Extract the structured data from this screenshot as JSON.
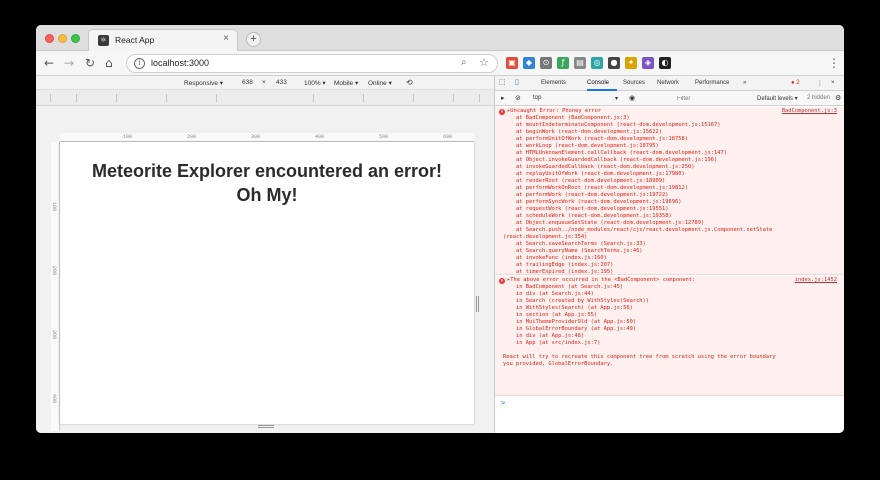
{
  "browser": {
    "tab_title": "React App",
    "tab_favicon": "⚛",
    "tab_close": "×",
    "new_tab": "+",
    "url": "localhost:3000",
    "back_icon": "←",
    "forward_icon": "→",
    "reload_icon": "↻",
    "home_icon": "⌂",
    "info_icon": "i",
    "search_icon": "⌕",
    "star_icon": "☆",
    "menu_icon": "⋮",
    "extensions": [
      {
        "name": "extension-red-icon",
        "color": "#e04b3f",
        "glyph": "▣"
      },
      {
        "name": "extension-blue-icon",
        "color": "#2f86d6",
        "glyph": "◆"
      },
      {
        "name": "extension-lens-icon",
        "color": "#777777",
        "glyph": "⊙"
      },
      {
        "name": "extension-green-icon",
        "color": "#3ba55c",
        "glyph": "ƒ"
      },
      {
        "name": "extension-gray-icon",
        "color": "#888888",
        "glyph": "▤"
      },
      {
        "name": "extension-teal-icon",
        "color": "#2ba5a5",
        "glyph": "◎"
      },
      {
        "name": "extension-dark-icon",
        "color": "#444444",
        "glyph": "●"
      },
      {
        "name": "extension-yellow-icon",
        "color": "#d9a400",
        "glyph": "✦"
      },
      {
        "name": "extension-purple-icon",
        "color": "#7d54c4",
        "glyph": "◈"
      },
      {
        "name": "extension-black-icon",
        "color": "#222222",
        "glyph": "◐"
      }
    ]
  },
  "device_toolbar": {
    "device": "Responsive ▾",
    "width": "638",
    "times": "×",
    "height": "433",
    "zoom": "100% ▾",
    "network": "Mobile ▾",
    "online": "Online ▾",
    "rotate_icon": "⟲"
  },
  "ruler": {
    "top_labels": [
      "100",
      "200",
      "300",
      "400",
      "500",
      "600"
    ],
    "left_labels": [
      "100",
      "200",
      "300",
      "400"
    ]
  },
  "page": {
    "error_line1": "Meteorite Explorer encountered an error!",
    "error_line2": "Oh My!"
  },
  "devtools": {
    "tabs": [
      "Elements",
      "Console",
      "Sources",
      "Network",
      "Performance",
      "»"
    ],
    "error_count": "2",
    "context": "top",
    "context_arrow": "▾",
    "eye_icon": "◉",
    "filter_placeholder": "Filter",
    "levels": "Default levels ▾",
    "hidden": "2 hidden",
    "settings_icon": "⚙",
    "clear_icon": "⊘",
    "more_icon": "⋮",
    "close_icon": "×"
  },
  "console": {
    "error1_lines": [
      "▸Uncaught Error: Phoney error",
      "    at BadComponent (BadComponent.js:3)",
      "    at mountIndeterminateComponent (react-dom.development.js:15167)",
      "    at beginWork (react-dom.development.js:15622)",
      "    at performUnitOfWork (react-dom.development.js:18758)",
      "    at workLoop (react-dom.development.js:18795)",
      "    at HTMLUnknownElement.callCallback (react-dom.development.js:147)",
      "    at Object.invokeGuardedCallback (react-dom.development.js:196)",
      "    at invokeGuardedCallback (react-dom.development.js:250)",
      "    at replayUnitOfWork (react-dom.development.js:17980)",
      "    at renderRoot (react-dom.development.js:18909)",
      "    at performWorkOnRoot (react-dom.development.js:19812)",
      "    at performWork (react-dom.development.js:19722)",
      "    at performSyncWork (react-dom.development.js:19696)",
      "    at requestWork (react-dom.development.js:19551)",
      "    at scheduleWork (react-dom.development.js:19358)",
      "    at Object.enqueueSetState (react-dom.development.js:12789)",
      "    at Search.push../node_modules/react/cjs/react.development.js.Component.setState",
      "(react.development.js:354)",
      "    at Search.saveSearchTerms (Search.js:33)",
      "    at Search.queryName (SearchTerms.js:46)",
      "    at invokeFunc (index.js:160)",
      "    at trailingEdge (index.js:207)",
      "    at timerExpired (index.js:195)"
    ],
    "error1_source": "BadComponent.js:3",
    "error2_lines": [
      "▸The above error occurred in the <BadComponent> component:",
      "    in BadComponent (at Search.js:45)",
      "    in div (at Search.js:44)",
      "    in Search (created by WithStyles(Search))",
      "    in WithStyles(Search) (at App.js:56)",
      "    in section (at App.js:55)",
      "    in MuiThemeProviderOld (at App.js:50)",
      "    in GlobalErrorBoundary (at App.js:49)",
      "    in div (at App.js:48)",
      "    in App (at src/index.js:7)",
      "",
      "React will try to recreate this component tree from scratch using the error boundary",
      "you provided, GlobalErrorBoundary."
    ],
    "error2_source": "index.js:1452",
    "prompt": ">"
  },
  "colors": {
    "error_text": "#dd2211",
    "error_bg": "#fff0f0",
    "accent": "#1a73e8"
  }
}
